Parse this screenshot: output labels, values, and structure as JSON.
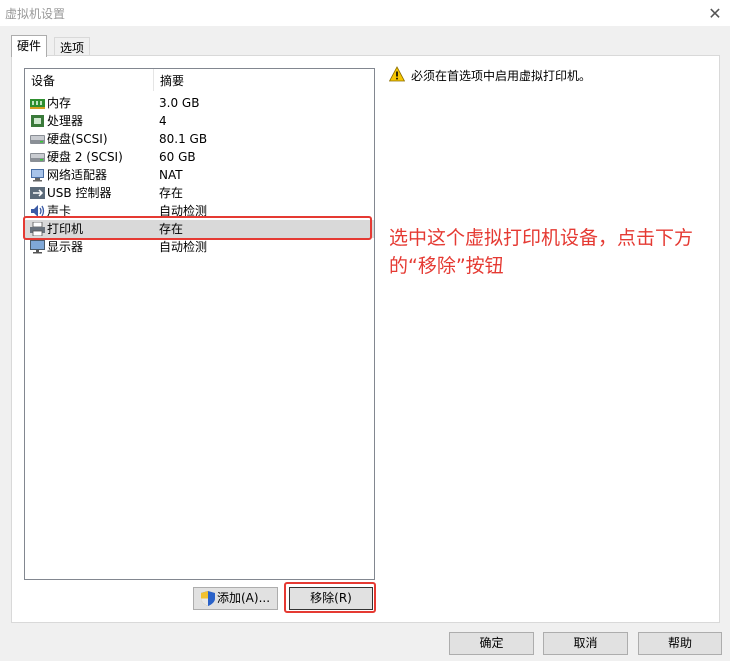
{
  "window": {
    "title": "虚拟机设置"
  },
  "tabs": [
    {
      "label": "硬件"
    },
    {
      "label": "选项"
    }
  ],
  "device_list": {
    "columns": [
      "设备",
      "摘要"
    ],
    "rows": [
      {
        "icon": "memory-icon",
        "device": "内存",
        "summary": "3.0 GB"
      },
      {
        "icon": "processor-icon",
        "device": "处理器",
        "summary": "4"
      },
      {
        "icon": "hard-disk-icon",
        "device": "硬盘(SCSI)",
        "summary": "80.1 GB"
      },
      {
        "icon": "hard-disk-icon",
        "device": "硬盘 2 (SCSI)",
        "summary": "60 GB"
      },
      {
        "icon": "network-adapter-icon",
        "device": "网络适配器",
        "summary": "NAT"
      },
      {
        "icon": "usb-icon",
        "device": "USB 控制器",
        "summary": "存在"
      },
      {
        "icon": "sound-card-icon",
        "device": "声卡",
        "summary": "自动检测"
      },
      {
        "icon": "printer-icon",
        "device": "打印机",
        "summary": "存在",
        "selected": true
      },
      {
        "icon": "display-icon",
        "device": "显示器",
        "summary": "自动检测"
      }
    ]
  },
  "warning": {
    "text": "必须在首选项中启用虚拟打印机。"
  },
  "annotation": {
    "text": "选中这个虚拟打印机设备，点击下方的“移除”按钮"
  },
  "buttons": {
    "add": "添加(A)...",
    "remove": "移除(R)",
    "ok": "确定",
    "cancel": "取消",
    "help": "帮助"
  },
  "colors": {
    "highlight": "#e53a33",
    "selection": "#d9d9d9"
  }
}
